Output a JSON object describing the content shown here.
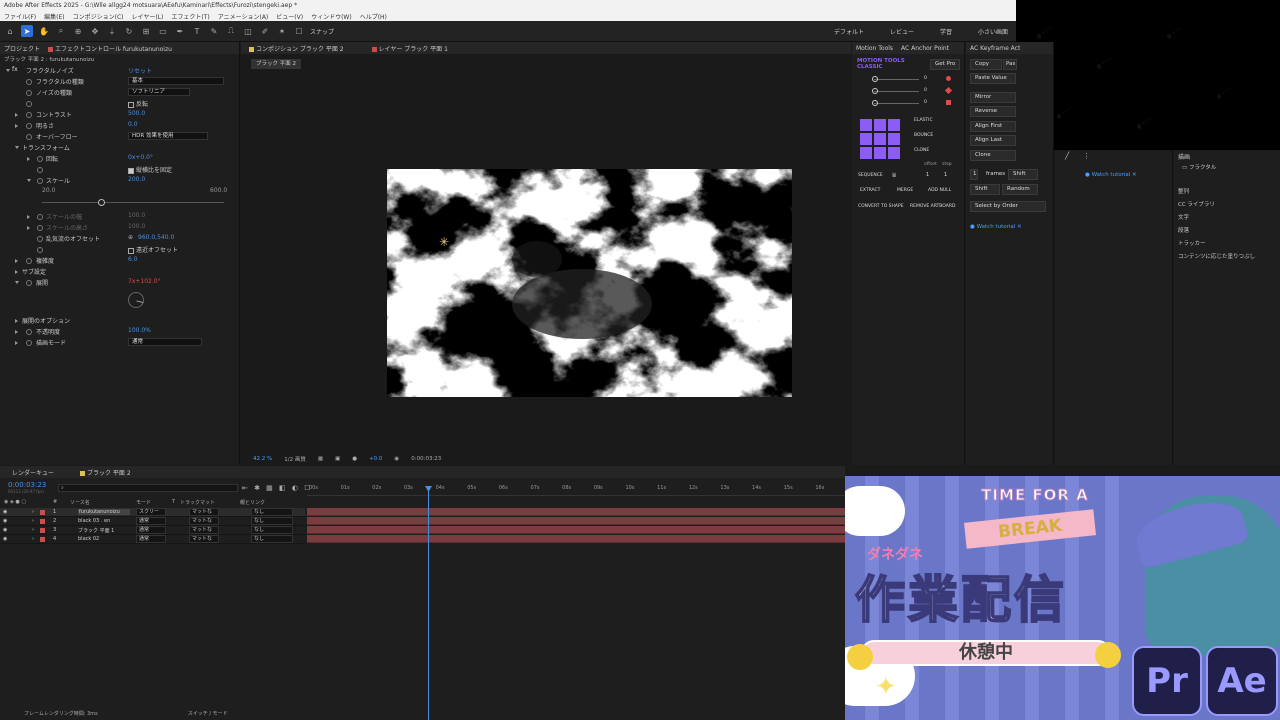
{
  "window": {
    "title": "Adobe After Effects 2025 - G:\\Wlle allgg24 motsuara\\AEefu\\Kaminari\\Effects\\Furozi\\stengeki.aep *",
    "menu": [
      "ファイル(F)",
      "編集(E)",
      "コンポジション(C)",
      "レイヤー(L)",
      "エフェクト(T)",
      "アニメーション(A)",
      "ビュー(V)",
      "ウィンドウ(W)",
      "ヘルプ(H)"
    ]
  },
  "toolbar": {
    "snap_label": "スナップ",
    "workspaces": [
      "デフォルト",
      "レビュー",
      "学習",
      "小さい画面"
    ]
  },
  "left_panel": {
    "tab_project": "プロジェクト",
    "tab_effects": "エフェクトコントロール furukutanunoizu",
    "layer_path": "ブラック 平面 2 : furukutanunoizu",
    "reset_label": "リセット",
    "props": [
      {
        "name": "フラクタルノイズ",
        "value": "リセット"
      },
      {
        "name": "フラクタルの種類",
        "value": "基本"
      },
      {
        "name": "ノイズの種類",
        "value": "ソフトリニア"
      },
      {
        "name": "",
        "value": "反転"
      },
      {
        "name": "コントラスト",
        "value": "500.0"
      },
      {
        "name": "明るさ",
        "value": "0.0"
      },
      {
        "name": "オーバーフロー",
        "value": "HDR 効果を使用"
      },
      {
        "name": "トランスフォーム",
        "value": ""
      },
      {
        "name": "回転",
        "value": "0x+0.0°"
      },
      {
        "name": "",
        "value": "縦横比を固定"
      },
      {
        "name": "スケール",
        "value": "200.0"
      },
      {
        "name": "",
        "value": ""
      },
      {
        "name": "スケールの幅",
        "value": "100.0"
      },
      {
        "name": "スケールの高さ",
        "value": "100.0"
      },
      {
        "name": "乱気流のオフセット",
        "value": "960.0,540.0"
      },
      {
        "name": "",
        "value": "遠近オフセット"
      },
      {
        "name": "複雑度",
        "value": "6.0"
      },
      {
        "name": "サブ設定",
        "value": ""
      },
      {
        "name": "展開",
        "value": "7x+102.0°"
      },
      {
        "name": "展開のオプション",
        "value": ""
      },
      {
        "name": "不透明度",
        "value": "100.0%"
      },
      {
        "name": "描画モード",
        "value": "通常"
      }
    ],
    "slider_min": "20.0",
    "slider_max": "600.0"
  },
  "composition": {
    "tab_comp": "コンポジション ブラック 平面 2",
    "tab_layer": "レイヤー ブラック 平面 1",
    "comp_button": "ブラック 平面 2",
    "zoom": "42.2 %",
    "resolution": "1/2 画質",
    "exposure": "+0.0",
    "timecode": "0:00:03:23"
  },
  "motion_tools": {
    "tab1": "Motion Tools",
    "tab2": "AC Anchor Point",
    "title": "MOTION TOOLS CLASSIC",
    "get_pro": "Get Pro",
    "slider_values": [
      "0",
      "0",
      "0"
    ],
    "elastic": "ELASTIC",
    "bounce": "BOUNCE",
    "clone": "CLONE",
    "offset": "offset",
    "step": "step",
    "sequence": "SEQUENCE",
    "seq_values": [
      "1",
      "1"
    ],
    "extract": "EXTRACT",
    "merge": "MERGE",
    "add_null": "ADD NULL",
    "convert": "CONVERT TO SHAPE",
    "remove": "REMOVE ARTBOARD"
  },
  "keyframe": {
    "tab": "AC Keyframe Act",
    "copy": "Copy",
    "paste": "Pas",
    "paste_value": "Paste Value",
    "mirror": "Mirror",
    "reverse": "Reverse",
    "align_first": "Align First",
    "align_last": "Align Last",
    "clone": "Clone",
    "frames_num": "1",
    "frames": "frames",
    "shift1": "Shift",
    "shift2": "Shift",
    "random": "Random",
    "select_order": "Select by Order",
    "watch_tutorial": "Watch tutorial",
    "watch_tutorial2": "Watch tutorial"
  },
  "library": {
    "header": "描画",
    "item": "フラクタル",
    "items": [
      "整列",
      "CC ライブラリ",
      "文字",
      "段落",
      "トラッカー",
      "コンテンツに応じた塗りつぶし"
    ]
  },
  "timeline": {
    "tab_render": "レンダーキュー",
    "tab_comp": "ブラック 平面 2",
    "timecode": "0:00:03:23",
    "frames": "00113 (29.97 fps)",
    "headers": [
      "#",
      "ソース名",
      "モード",
      "T",
      "トラックマット",
      "親とリンク"
    ],
    "layers": [
      {
        "num": "1",
        "name": "furukutanunoizu",
        "mode": "スクリー",
        "matte": "マットな",
        "parent": "なし",
        "color": "#c94f4f"
      },
      {
        "num": "2",
        "name": "black 03 . en",
        "mode": "通常",
        "matte": "マットな",
        "parent": "なし",
        "color": "#c94f4f"
      },
      {
        "num": "3",
        "name": "ブラック 平面 1",
        "mode": "通常",
        "matte": "マットな",
        "parent": "なし",
        "color": "#c94f4f"
      },
      {
        "num": "4",
        "name": "black 02",
        "mode": "通常",
        "matte": "マットな",
        "parent": "なし",
        "color": "#c94f4f"
      }
    ],
    "ruler": [
      "00s",
      "01s",
      "02s",
      "03s",
      "04s",
      "05s",
      "06s",
      "07s",
      "08s",
      "09s",
      "10s",
      "11s",
      "12s",
      "13s",
      "14s",
      "15s",
      "16s"
    ],
    "footer_left": "フレームレンダリング時間: 3ms",
    "footer_right": "スイッチ / モード"
  },
  "overlay": {
    "time_for_a": "TIME FOR A",
    "break": "BREAK",
    "furigana": "ダネダネ",
    "main": "作業配信",
    "sub": "休憩中",
    "pr": "Pr",
    "ae": "Ae"
  },
  "colors": {
    "accent": "#2d6fd6",
    "value_blue": "#4a90e2",
    "layer_bar": "#7a3c3e",
    "overlay_bg": "#6a76c8"
  }
}
